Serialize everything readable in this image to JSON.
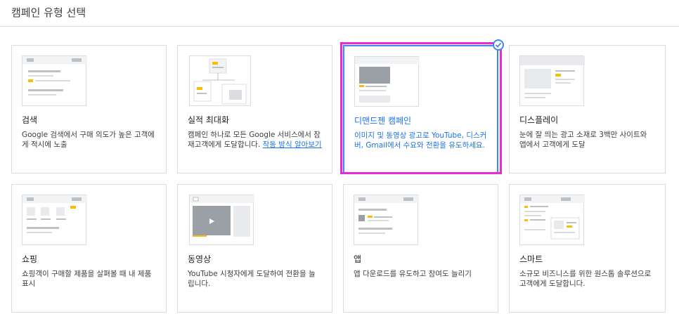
{
  "header": {
    "title": "캠페인 유형 선택"
  },
  "cards": [
    {
      "name": "검색",
      "desc": "Google 검색에서 구매 의도가 높은 고객에게 적시에 노출"
    },
    {
      "name": "실적 최대화",
      "desc": "캠페인 하나로 모든 Google 서비스에서 잠재고객에게 도달합니다.",
      "link": "작동 방식 알아보기"
    },
    {
      "name": "디맨드젠 캠페인",
      "desc": "이미지 및 동영상 광고로 YouTube, 디스커버, Gmail에서 수요와 전환을 유도하세요.",
      "selected": true
    },
    {
      "name": "디스플레이",
      "desc": "눈에 잘 띄는 광고 소재로 3백만 사이트와 앱에서 고객에게 도달"
    },
    {
      "name": "쇼핑",
      "desc": "쇼핑객이 구매할 제품을 살펴볼 때 내 제품 표시"
    },
    {
      "name": "동영상",
      "desc": "YouTube 시청자에게 도달하여 전환을 늘립니다."
    },
    {
      "name": "앱",
      "desc": "앱 다운로드를 유도하고 참여도 늘리기"
    },
    {
      "name": "스마트",
      "desc": "소규모 비즈니스를 위한 원스톱 솔루션으로 고객에게 도달합니다."
    }
  ],
  "colors": {
    "accent": "#1a73e8",
    "highlight": "#e829d6",
    "thumb_yellow": "#fbbc04"
  }
}
